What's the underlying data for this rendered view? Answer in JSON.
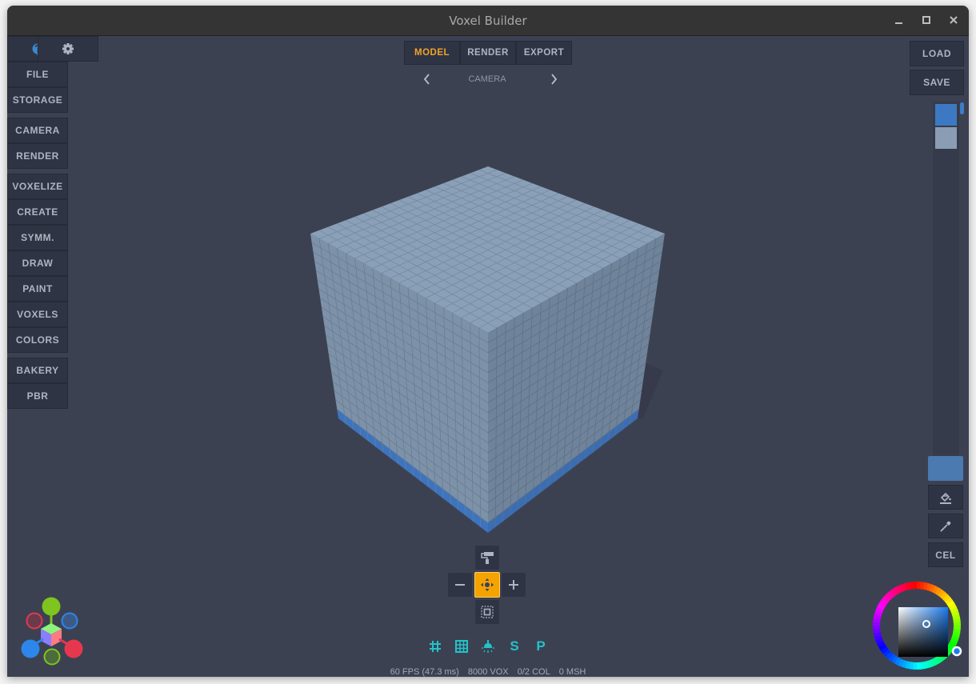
{
  "window": {
    "title": "Voxel Builder",
    "controls": {
      "minimize": "_",
      "maximize": "▢",
      "close": "✕"
    }
  },
  "sidebar_left": {
    "top_icons": [
      {
        "name": "help-icon",
        "glyph": "?"
      },
      {
        "name": "gear-icon",
        "glyph": "⚙"
      }
    ],
    "groups": [
      [
        "FILE",
        "STORAGE"
      ],
      [
        "CAMERA",
        "RENDER"
      ],
      [
        "VOXELIZE",
        "CREATE",
        "SYMM.",
        "DRAW",
        "PAINT",
        "VOXELS",
        "COLORS"
      ],
      [
        "BAKERY",
        "PBR"
      ]
    ]
  },
  "top_tabs": {
    "items": [
      "MODEL",
      "RENDER",
      "EXPORT"
    ],
    "active": "MODEL"
  },
  "camera_nav": {
    "label": "CAMERA",
    "prev": "‹",
    "next": "›"
  },
  "sidebar_right": {
    "load_label": "LOAD",
    "save_label": "SAVE",
    "palette": [
      "#3d79c2",
      "#8a9db3"
    ],
    "current_color": "#4a7ab0",
    "tools": [
      {
        "name": "fill-bucket-icon"
      },
      {
        "name": "eyedropper-icon"
      },
      {
        "name": "cel-button",
        "label": "CEL"
      }
    ]
  },
  "model": {
    "size": 20,
    "voxel_color": "#8ca1b8",
    "base_layer_color": "#3d74c0",
    "background": "#3c4152"
  },
  "gizmo": {
    "top": "paint-roller-icon",
    "left": "−",
    "center": "move-icon",
    "right": "+",
    "bottom": "select-box-icon"
  },
  "toggles": [
    {
      "name": "grid-icon",
      "glyph": "#"
    },
    {
      "name": "grid-frame-icon",
      "glyph": "▦"
    },
    {
      "name": "light-icon",
      "glyph": "💡"
    },
    {
      "name": "s-toggle",
      "glyph": "S"
    },
    {
      "name": "p-toggle",
      "glyph": "P"
    }
  ],
  "toggle_color": "#22c3c9",
  "stats": {
    "fps": "60 FPS (47.3 ms)",
    "voxels": "8000 VOX",
    "colors": "0/2 COL",
    "meshes": "0 MSH"
  },
  "color_picker": {
    "hue_color": "#1e7bea"
  },
  "accent_color": "#f4a300"
}
